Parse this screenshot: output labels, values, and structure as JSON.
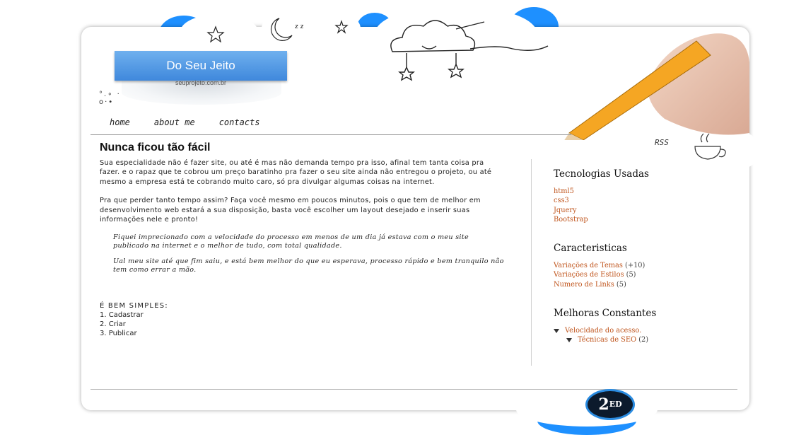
{
  "header": {
    "logo_title": "Do Seu Jeito",
    "site_url": "seuprojeto.com.br",
    "rss_label": "RSS"
  },
  "nav": {
    "items": [
      {
        "label": "home"
      },
      {
        "label": "about me"
      },
      {
        "label": "contacts"
      }
    ]
  },
  "main": {
    "title": "Nunca ficou tão fácil",
    "paragraphs": [
      "Sua especialidade não é fazer site, ou até é mas não demanda tempo pra isso, afinal tem tanta coisa pra fazer. e o rapaz que te cobrou um preço baratinho pra fazer o seu site ainda não entregou o projeto, ou até mesmo a empresa está te cobrando muito caro, só pra divulgar algumas coisas na internet.",
      "Pra que perder tanto tempo assim? Faça você mesmo em poucos minutos, pois o que tem de melhor em desenvolvimento web estará a sua disposição, basta você escolher um layout desejado e inserir suas informações nele e pronto!"
    ],
    "quotes": [
      "Fiquei imprecionado com a velocidade do processo em menos de um dia já estava com o meu site publicado na internet e o melhor de tudo, com total qualidade.",
      "Ual meu site até que fim saiu, e está bem melhor do que eu esperava, processo rápido e bem tranquilo não tem como errar a mão."
    ],
    "steps_heading": "É BEM SIMPLES:",
    "steps": [
      "1. Cadastrar",
      "2. Criar",
      "3. Publicar"
    ]
  },
  "sidebar": {
    "sections": [
      {
        "heading": "Tecnologias Usadas",
        "items": [
          {
            "label": "html5",
            "count": ""
          },
          {
            "label": "css3",
            "count": ""
          },
          {
            "label": "Jquery",
            "count": ""
          },
          {
            "label": "Bootstrap",
            "count": ""
          }
        ]
      },
      {
        "heading": "Caracteristicas",
        "items": [
          {
            "label": "Variações de Temas",
            "count": "(+10)"
          },
          {
            "label": "Variações de Estilos",
            "count": "(5)"
          },
          {
            "label": "Numero de Links",
            "count": "(5)"
          }
        ]
      },
      {
        "heading": "Melhoras Constantes",
        "items": [
          {
            "label": "Velocidade do acesso.",
            "count": ""
          },
          {
            "label": "Técnicas de SEO",
            "count": "(2)"
          }
        ]
      }
    ]
  },
  "footer": {
    "badge_big": "2",
    "badge_small": "ED"
  },
  "colors": {
    "accent_blue": "#1e90ff",
    "link_orange": "#c0561e",
    "logo_blue": "#4a90e2"
  }
}
